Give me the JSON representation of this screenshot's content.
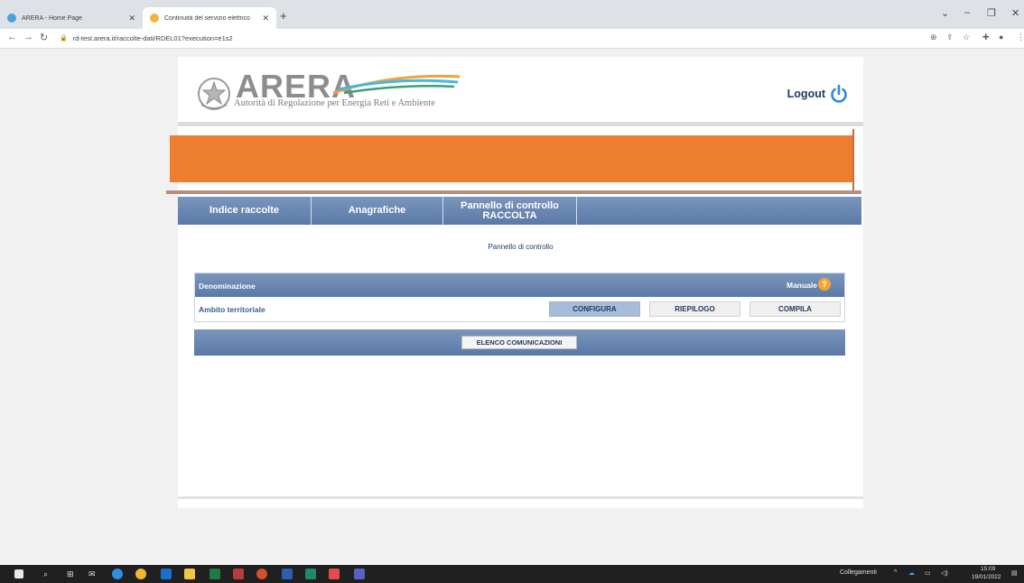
{
  "browser": {
    "tabs": [
      {
        "title": "ARERA - Home Page",
        "active": false
      },
      {
        "title": "Continuità del servizio elettrico",
        "active": true
      }
    ],
    "new_tab_label": "+",
    "url": "rd-test.arera.it/raccolte-dati/RDEL01?execution=e1s2"
  },
  "header": {
    "logo_word": "ARERA",
    "logo_subtitle": "Autorità di Regolazione per Energia Reti e Ambiente",
    "logout_label": "Logout"
  },
  "nav": {
    "items": [
      {
        "label": "Indice raccolte"
      },
      {
        "label": "Anagrafiche"
      },
      {
        "label": "Pannello di controllo RACCOLTA"
      }
    ]
  },
  "main": {
    "subtitle": "Pannello di controllo",
    "table": {
      "header_label": "Denominazione",
      "manual_label": "Manuale",
      "manual_icon": "?",
      "row_label": "Ambito territoriale",
      "buttons": [
        "CONFIGURA",
        "RIEPILOGO",
        "COMPILA"
      ],
      "active_button": "CONFIGURA"
    },
    "comm_button_label": "ELENCO COMUNICAZIONI"
  },
  "taskbar": {
    "links_label": "Collegamenti",
    "time": "15:09",
    "date": "19/01/2022"
  },
  "colors": {
    "banner": "#ed7d31",
    "nav_blue": "#6a88b2",
    "logout_blue": "#1f3b63",
    "accent_orange": "#f7a52c"
  }
}
